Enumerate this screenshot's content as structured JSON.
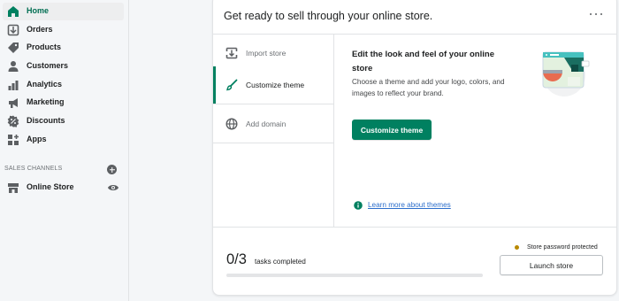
{
  "sidebar": {
    "items": [
      {
        "label": "Home",
        "icon": "home-icon",
        "active": true
      },
      {
        "label": "Orders",
        "icon": "orders-icon"
      },
      {
        "label": "Products",
        "icon": "tag-icon"
      },
      {
        "label": "Customers",
        "icon": "person-icon"
      },
      {
        "label": "Analytics",
        "icon": "bar-chart-icon"
      },
      {
        "label": "Marketing",
        "icon": "marketing-icon"
      },
      {
        "label": "Discounts",
        "icon": "discount-icon"
      },
      {
        "label": "Apps",
        "icon": "apps-icon"
      }
    ],
    "channels_label": "SALES CHANNELS",
    "channels": [
      {
        "label": "Online Store",
        "icon": "store-icon",
        "action_icon": "eye-icon"
      }
    ]
  },
  "card": {
    "title": "Get ready to sell through your online store.",
    "tabs": [
      {
        "label": "Import store",
        "icon": "import-icon"
      },
      {
        "label": "Customize theme",
        "icon": "brush-icon",
        "active": true
      },
      {
        "label": "Add domain",
        "icon": "globe-icon"
      }
    ],
    "panel": {
      "heading": "Edit the look and feel of your online store",
      "description": "Choose a theme and add your logo, colors, and images to reflect your brand.",
      "button_label": "Customize theme",
      "link_text": "Learn more about themes"
    },
    "footer": {
      "count": "0/3",
      "label": "tasks completed",
      "progress_fraction": 0,
      "password_status": "Store password protected",
      "launch_label": "Launch store"
    }
  },
  "colors": {
    "accent": "#008060",
    "link": "#2c6ecb",
    "status_warning": "#b98900"
  }
}
